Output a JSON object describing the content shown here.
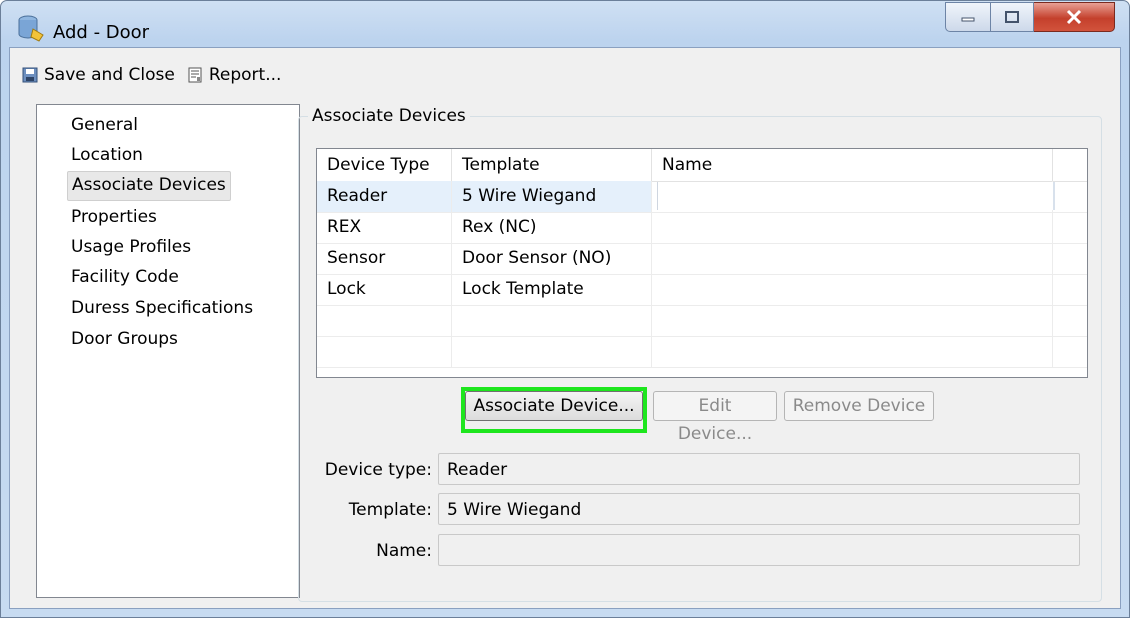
{
  "window": {
    "title": "Add - Door"
  },
  "toolbar": {
    "save_label": "Save and Close",
    "report_label": "Report..."
  },
  "nav": {
    "items": [
      {
        "label": "General"
      },
      {
        "label": "Location"
      },
      {
        "label": "Associate Devices"
      },
      {
        "label": "Properties"
      },
      {
        "label": "Usage Profiles"
      },
      {
        "label": "Facility Code"
      },
      {
        "label": "Duress Specifications"
      },
      {
        "label": "Door Groups"
      }
    ],
    "selected": "Associate Devices"
  },
  "associate": {
    "group_title": "Associate Devices",
    "columns": [
      "Device Type",
      "Template",
      "Name"
    ],
    "rows": [
      {
        "type": "Reader",
        "template": "5 Wire Wiegand",
        "name": ""
      },
      {
        "type": "REX",
        "template": "Rex (NC)",
        "name": ""
      },
      {
        "type": "Sensor",
        "template": "Door Sensor (NO)",
        "name": ""
      },
      {
        "type": "Lock",
        "template": "Lock Template",
        "name": ""
      }
    ],
    "buttons": {
      "associate": "Associate Device...",
      "edit": "Edit Device...",
      "remove": "Remove Device"
    },
    "details": {
      "device_type_label": "Device type:",
      "device_type_value": "Reader",
      "template_label": "Template:",
      "template_value": "5 Wire Wiegand",
      "name_label": "Name:",
      "name_value": ""
    }
  },
  "colors": {
    "highlight": "#1ee61e",
    "close_button": "#c4402c"
  },
  "icons": [
    "app-database-icon",
    "minimize-icon",
    "maximize-icon",
    "close-icon",
    "save-icon",
    "report-icon"
  ]
}
